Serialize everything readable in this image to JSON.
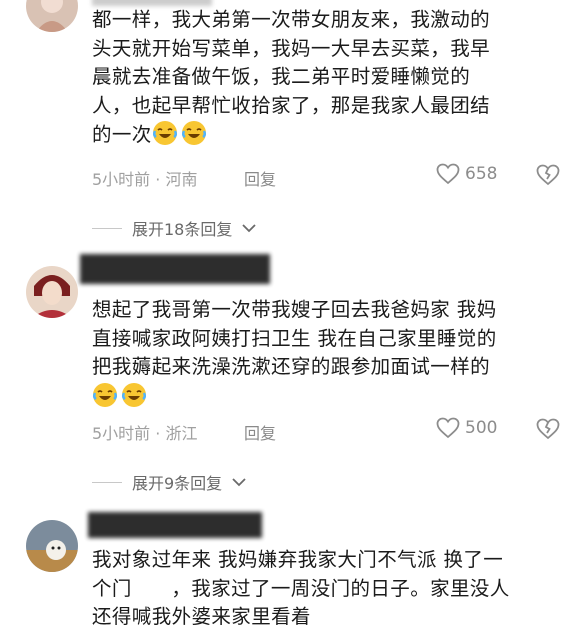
{
  "comments": [
    {
      "text_lines": [
        "都一样，我大弟第一次带女朋友来，我激动的",
        "头天就开始写菜单，我妈一大早去买菜，我早",
        "晨就去准备做午饭，我二弟平时爱睡懒觉的",
        "人，也起早帮忙收拾家了，那是我家人最团结",
        "的一次"
      ],
      "emojis": [
        "laughing-crying-emoji",
        "laughing-crying-emoji"
      ],
      "time_location": "5小时前 · 河南",
      "reply_label": "回复",
      "like_count": "658",
      "expand_label": "展开18条回复"
    },
    {
      "text_lines": [
        "想起了我哥第一次带我嫂子回去我爸妈家 我妈",
        "直接喊家政阿姨打扫卫生 我在自己家里睡觉的",
        "把我薅起来洗澡洗漱还穿的跟参加面试一样的"
      ],
      "emojis": [
        "laughing-crying-emoji",
        "laughing-crying-emoji"
      ],
      "time_location": "5小时前 · 浙江",
      "reply_label": "回复",
      "like_count": "500",
      "expand_label": "展开9条回复"
    },
    {
      "text_lines": [
        "我对象过年来 我妈嫌弃我家大门不气派 换了一",
        "个门      ，我家过了一周没门的日子。家里没人",
        "还得喊我外婆来家里看着"
      ]
    }
  ],
  "colors": {
    "text": "#1b1b1b",
    "meta": "#a0a0a0",
    "icon": "#8c8c8c"
  }
}
